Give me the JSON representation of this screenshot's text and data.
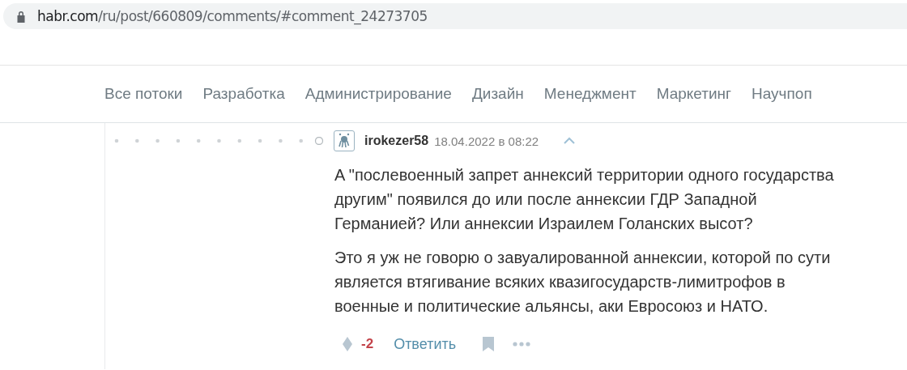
{
  "address_bar": {
    "host": "habr.com",
    "path": "/ru/post/660809/comments/#comment_24273705"
  },
  "nav": {
    "tabs": [
      {
        "label": "Все потоки",
        "selected": false
      },
      {
        "label": "Разработка",
        "selected": false
      },
      {
        "label": "Администрирование",
        "selected": false
      },
      {
        "label": "Дизайн",
        "selected": false
      },
      {
        "label": "Менеджмент",
        "selected": false
      },
      {
        "label": "Маркетинг",
        "selected": false
      },
      {
        "label": "Научпоп",
        "selected": false
      }
    ]
  },
  "comment": {
    "author": "irokezer58",
    "date": "18.04.2022 в 08:22",
    "paragraphs": [
      "A \"послевоенный запрет аннексий территории одного государства другим\" появился до или после аннексии ГДР Западной Германией? Или аннексии Израилем Голанских высот?",
      "Это я уж не говорю о завуалированной аннексии, которой по сути является втягивание всяких квазигосударств-лимитрофов в военные и политические альянсы, аки Евросоюз и НАТО."
    ],
    "score": "-2",
    "reply": "Ответить"
  }
}
